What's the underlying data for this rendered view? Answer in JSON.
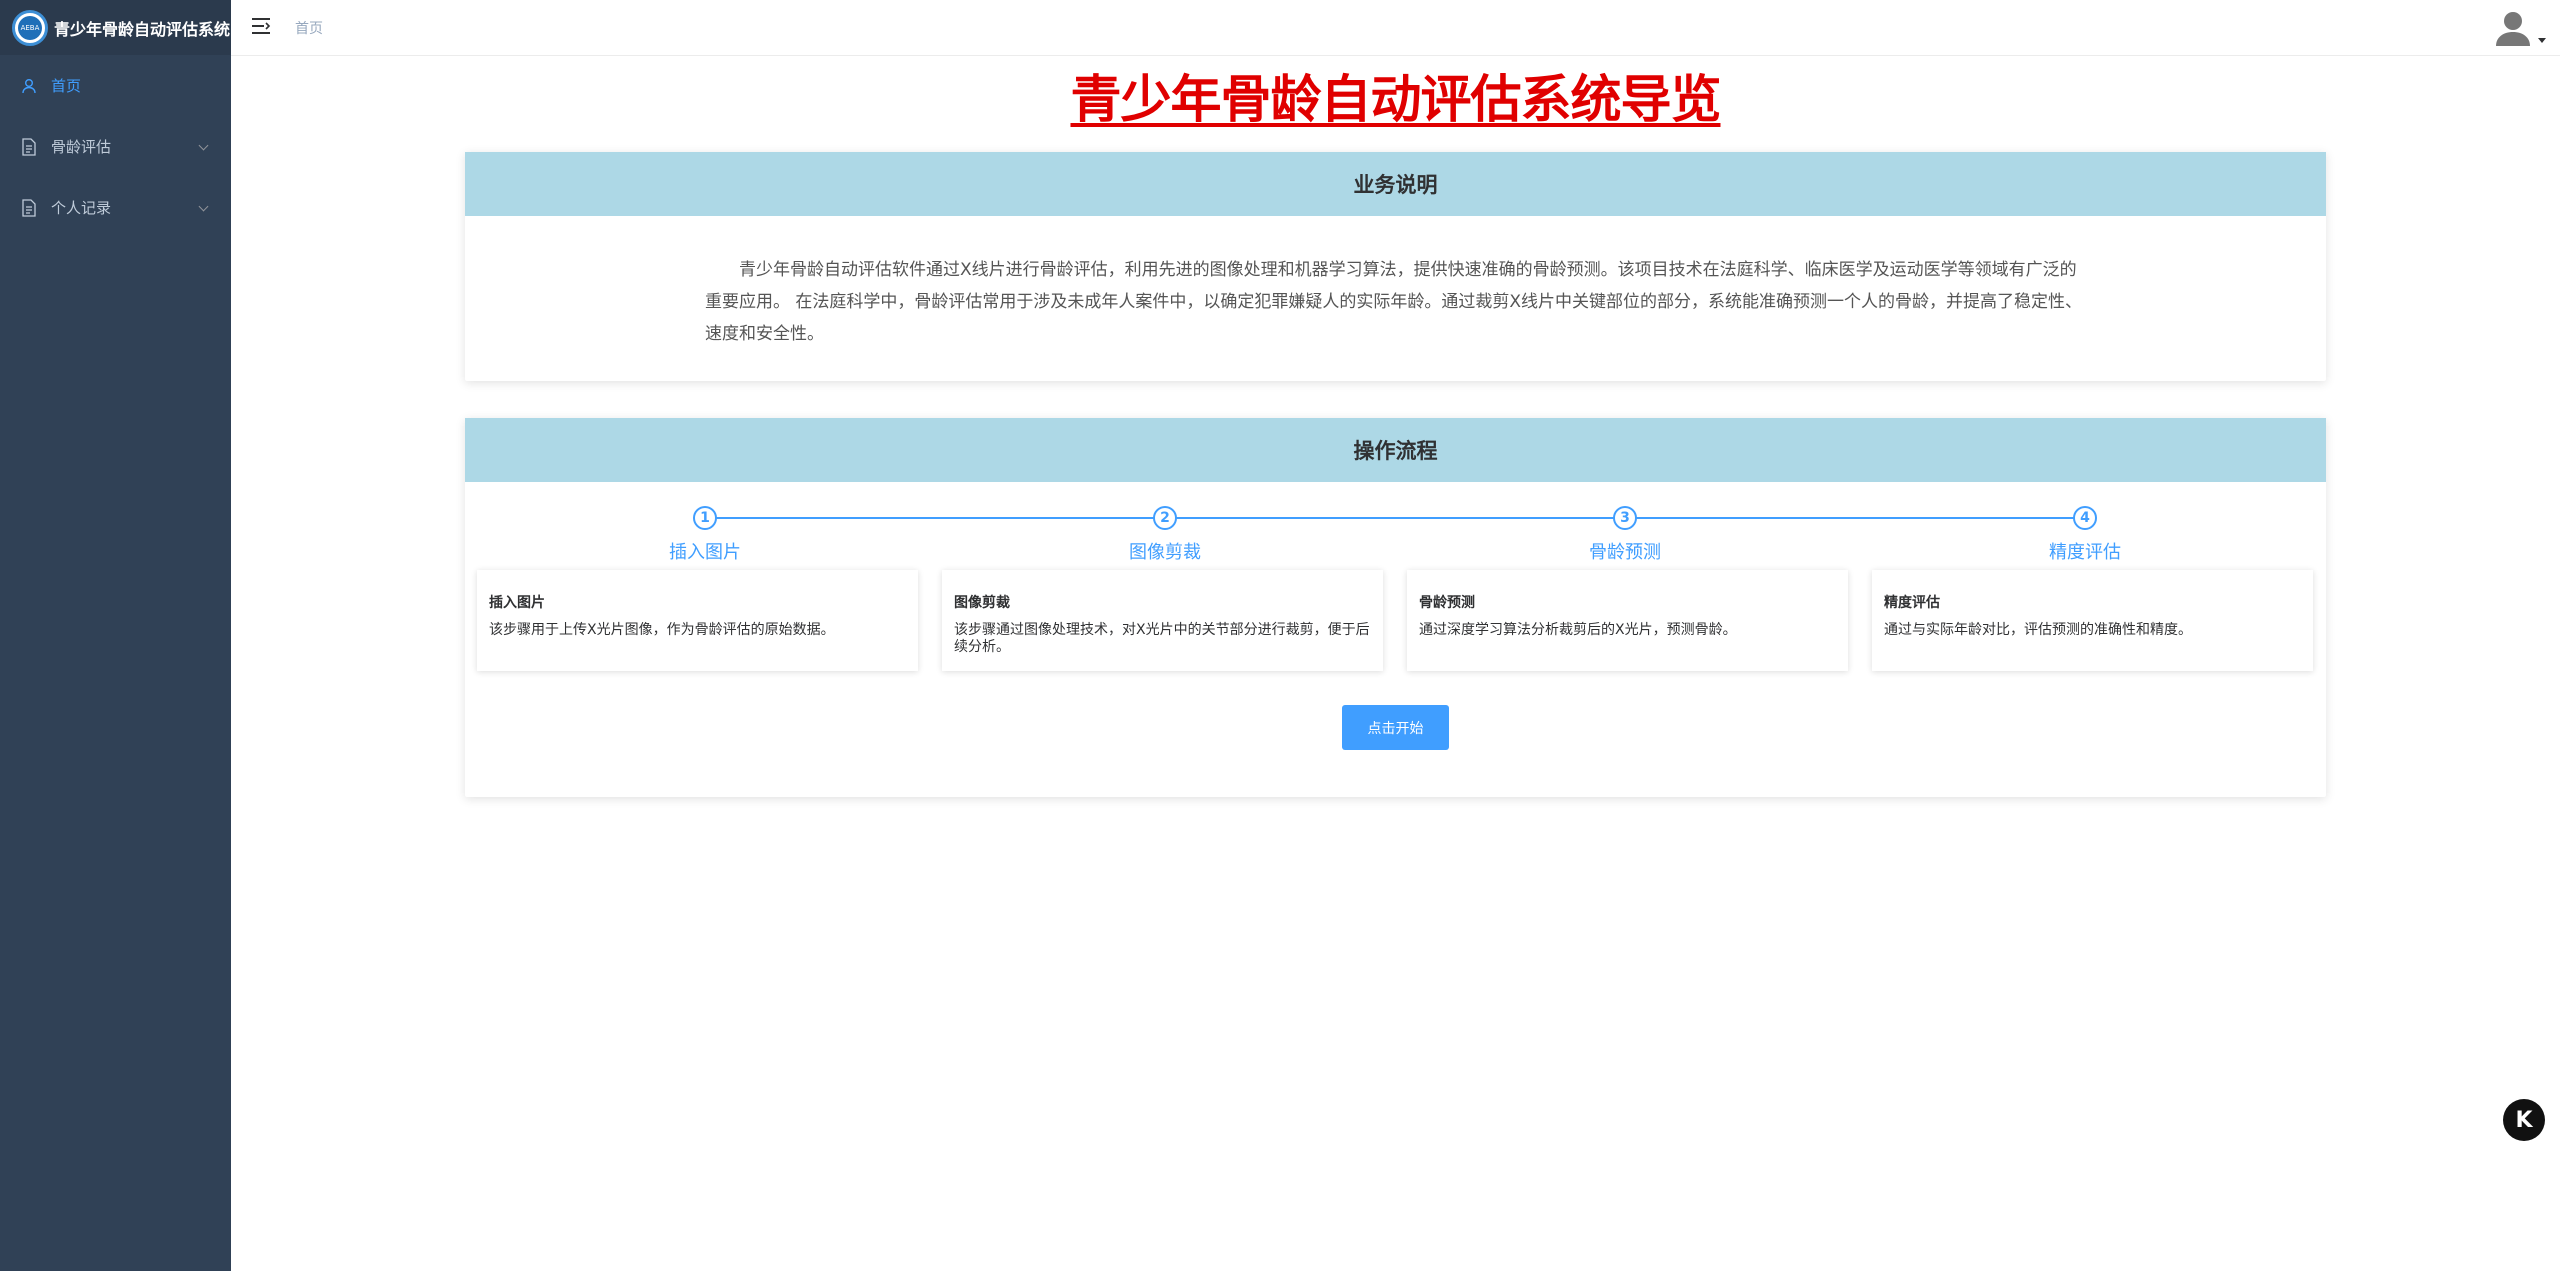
{
  "app": {
    "title": "青少年骨龄自动评估系统",
    "logo_text": "AEBA"
  },
  "sidebar": {
    "items": [
      {
        "label": "首页",
        "icon": "user-icon",
        "active": true
      },
      {
        "label": "骨龄评估",
        "icon": "document-icon",
        "expandable": true
      },
      {
        "label": "个人记录",
        "icon": "document-icon",
        "expandable": true
      }
    ]
  },
  "header": {
    "breadcrumb": "首页"
  },
  "main": {
    "title": "青少年骨龄自动评估系统导览",
    "business": {
      "heading": "业务说明",
      "text": "青少年骨龄自动评估软件通过X线片进行骨龄评估，利用先进的图像处理和机器学习算法，提供快速准确的骨龄预测。该项目技术在法庭科学、临床医学及运动医学等领域有广泛的重要应用。 在法庭科学中，骨龄评估常用于涉及未成年人案件中，以确定犯罪嫌疑人的实际年龄。通过裁剪X线片中关键部位的部分，系统能准确预测一个人的骨龄，并提高了稳定性、速度和安全性。"
    },
    "process": {
      "heading": "操作流程",
      "steps": [
        {
          "num": "1",
          "label": "插入图片",
          "card_title": "插入图片",
          "card_text": "该步骤用于上传X光片图像，作为骨龄评估的原始数据。"
        },
        {
          "num": "2",
          "label": "图像剪裁",
          "card_title": "图像剪裁",
          "card_text": "该步骤通过图像处理技术，对X光片中的关节部分进行裁剪，便于后续分析。"
        },
        {
          "num": "3",
          "label": "骨龄预测",
          "card_title": "骨龄预测",
          "card_text": "通过深度学习算法分析裁剪后的X光片，预测骨龄。"
        },
        {
          "num": "4",
          "label": "精度评估",
          "card_title": "精度评估",
          "card_text": "通过与实际年龄对比，评估预测的准确性和精度。"
        }
      ],
      "start_button": "点击开始"
    }
  },
  "floating": {
    "label": "K"
  },
  "colors": {
    "sidebar_bg": "#304156",
    "accent": "#409eff",
    "card_header": "#add8e6",
    "title_red": "#e00000"
  }
}
